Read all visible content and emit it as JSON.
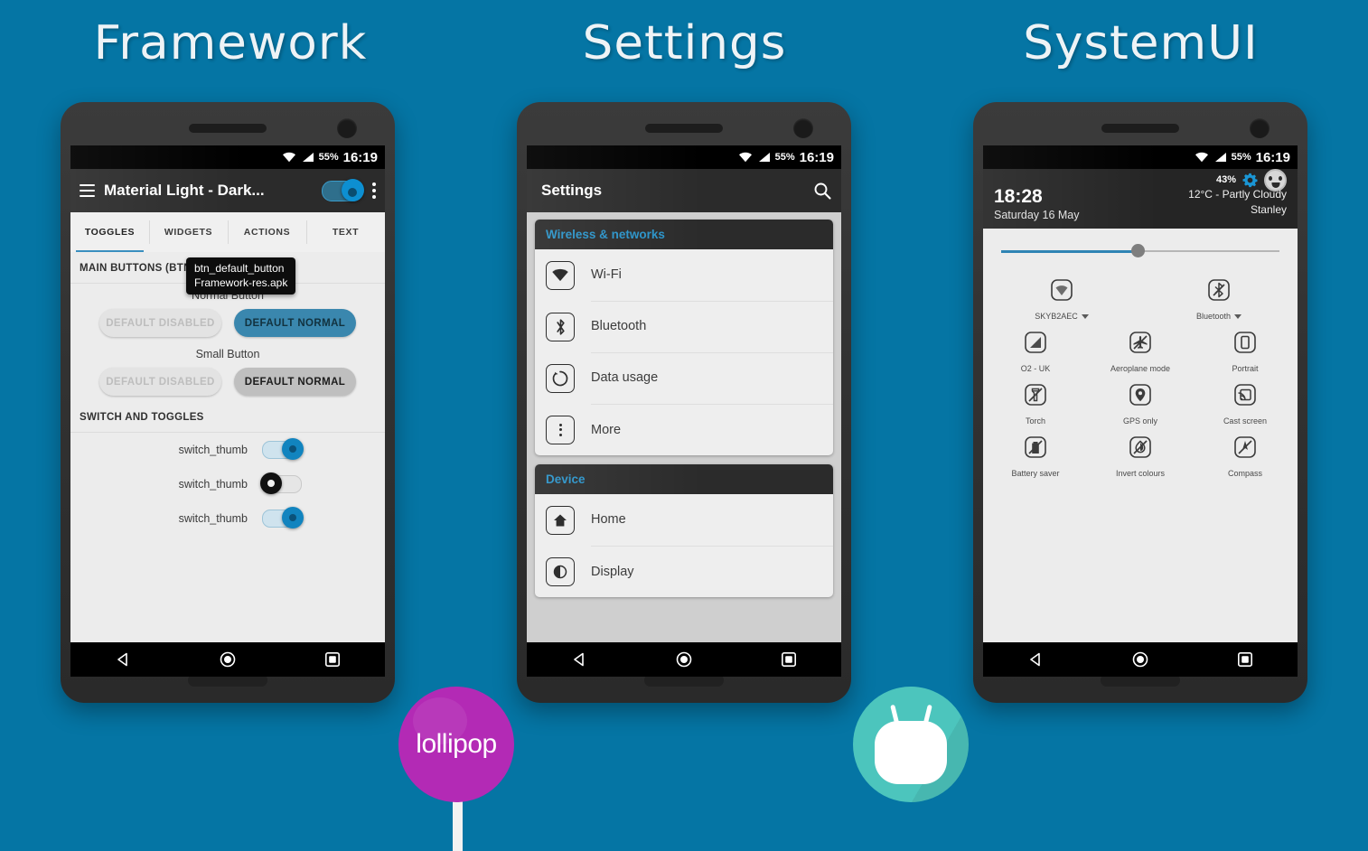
{
  "background_color": "#0575a4",
  "headings": [
    {
      "id": "framework",
      "text": "Framework"
    },
    {
      "id": "settings",
      "text": "Settings"
    },
    {
      "id": "systemui",
      "text": "SystemUI"
    }
  ],
  "status_bar": {
    "battery": "55%",
    "time": "16:19",
    "wifi_icon": "wifi-icon",
    "signal_icon": "signal-icon"
  },
  "phone1": {
    "appbar": {
      "menu_icon": "hamburger-menu-icon",
      "title": "Material Light - Dark...",
      "switch_state": "on",
      "overflow_icon": "overflow-menu-icon"
    },
    "tabs": [
      {
        "label": "TOGGLES",
        "active": true
      },
      {
        "label": "WIDGETS",
        "active": false
      },
      {
        "label": "ACTIONS",
        "active": false
      },
      {
        "label": "TEXT",
        "active": false
      }
    ],
    "section_main_buttons": "MAIN BUTTONS (BTN_DEFAULT)",
    "tooltip": {
      "line1": "btn_default_button",
      "line2": "Framework-res.apk"
    },
    "normal_button_label": "Normal Button",
    "normal_buttons": [
      {
        "label": "DEFAULT DISABLED",
        "style": "disabled"
      },
      {
        "label": "DEFAULT NORMAL",
        "style": "normal-blue"
      }
    ],
    "small_button_label": "Small Button",
    "small_buttons": [
      {
        "label": "DEFAULT DISABLED",
        "style": "disabled"
      },
      {
        "label": "DEFAULT NORMAL",
        "style": "normal-grey"
      }
    ],
    "section_switches": "SWITCH AND TOGGLES",
    "switches": [
      {
        "label": "switch_thumb",
        "state": "on"
      },
      {
        "label": "switch_thumb",
        "state": "off"
      },
      {
        "label": "switch_thumb",
        "state": "on"
      }
    ]
  },
  "phone2": {
    "appbar": {
      "title": "Settings",
      "search_icon": "search-icon"
    },
    "groups": [
      {
        "header": "Wireless & networks",
        "items": [
          {
            "label": "Wi-Fi",
            "icon": "wifi-icon"
          },
          {
            "label": "Bluetooth",
            "icon": "bluetooth-icon"
          },
          {
            "label": "Data usage",
            "icon": "data-usage-icon"
          },
          {
            "label": "More",
            "icon": "more-dots-icon"
          }
        ]
      },
      {
        "header": "Device",
        "items": [
          {
            "label": "Home",
            "icon": "home-icon"
          },
          {
            "label": "Display",
            "icon": "display-icon"
          }
        ]
      }
    ]
  },
  "phone3": {
    "quick_settings": {
      "battery_percent": "43%",
      "gear_icon": "settings-gear-icon",
      "avatar_icon": "user-avatar-icon",
      "time": "18:28",
      "date": "Saturday 16 May",
      "weather": "12°C - Partly Cloudy",
      "location": "Stanley",
      "brightness_percent": 49
    },
    "tiles_row1": [
      {
        "label": "SKYB2AEC",
        "icon": "wifi-icon",
        "caret": true
      },
      {
        "label": "Bluetooth",
        "icon": "bluetooth-off-icon",
        "caret": true
      }
    ],
    "tiles_row2": [
      {
        "label": "O2 - UK",
        "icon": "cellular-signal-icon",
        "caret": false
      },
      {
        "label": "Aeroplane mode",
        "icon": "aeroplane-off-icon",
        "caret": false
      },
      {
        "label": "Portrait",
        "icon": "rotation-portrait-icon",
        "caret": false
      }
    ],
    "tiles_row3": [
      {
        "label": "Torch",
        "icon": "torch-off-icon",
        "caret": false
      },
      {
        "label": "GPS only",
        "icon": "location-icon",
        "caret": false
      },
      {
        "label": "Cast screen",
        "icon": "cast-screen-icon",
        "caret": false
      }
    ],
    "tiles_row4": [
      {
        "label": "Battery saver",
        "icon": "battery-saver-off-icon",
        "caret": false
      },
      {
        "label": "Invert colours",
        "icon": "invert-colours-off-icon",
        "caret": false
      },
      {
        "label": "Compass",
        "icon": "compass-off-icon",
        "caret": false
      }
    ]
  },
  "nav_bar": {
    "back_icon": "back-triangle-icon",
    "home_icon": "home-circle-icon",
    "recents_icon": "recents-square-icon"
  },
  "logos": {
    "lollipop": {
      "text": "lollipop",
      "color": "#b32ab5"
    },
    "marshmallow": {
      "label": "marshmallow-logo",
      "color": "#4cc5bd"
    }
  }
}
